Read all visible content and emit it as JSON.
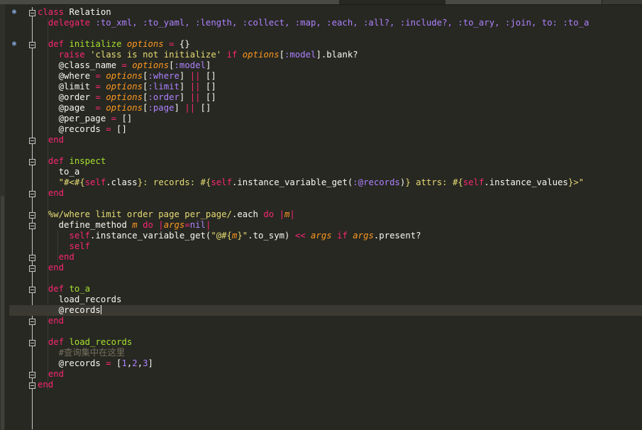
{
  "lines": [
    "class Relation",
    "  delegate :to_xml, :to_yaml, :length, :collect, :map, :each, :all?, :include?, :to_ary, :join, to: :to_a",
    "",
    "  def initialize options = {}",
    "    raise 'class is not initialize' if options[:model].blank?",
    "    @class_name = options[:model]",
    "    @where = options[:where] || []",
    "    @limit = options[:limit] || []",
    "    @order = options[:order] || []",
    "    @page  = options[:page] || []",
    "    @per_page = []",
    "    @records = []",
    "  end",
    "",
    "  def inspect",
    "    to_a",
    "    \"#<#{self.class}: records: #{self.instance_variable_get(:@records)} attrs: #{self.instance_values}>\"",
    "  end",
    "",
    "  %w/where limit order page per_page/.each do |m|",
    "    define_method m do |args=nil|",
    "      self.instance_variable_get(\"@#{m}\".to_sym) << args if args.present?",
    "      self",
    "    end",
    "  end",
    "",
    "  def to_a",
    "    load_records",
    "    @records",
    "  end",
    "",
    "  def load_records",
    "    #查询集中在这里",
    "    @records = [1,2,3]",
    "  end",
    "end"
  ],
  "current_line": 29,
  "colors": {
    "background": "#272822",
    "keyword": "#f92672",
    "function": "#a6e22e",
    "symbol": "#ae81ff",
    "string": "#e6db74",
    "argument": "#fd971f",
    "comment": "#75715e",
    "text": "#f8f8f2"
  },
  "icons": [
    "bookmark-marker-icon",
    "fold-toggle-icon"
  ]
}
